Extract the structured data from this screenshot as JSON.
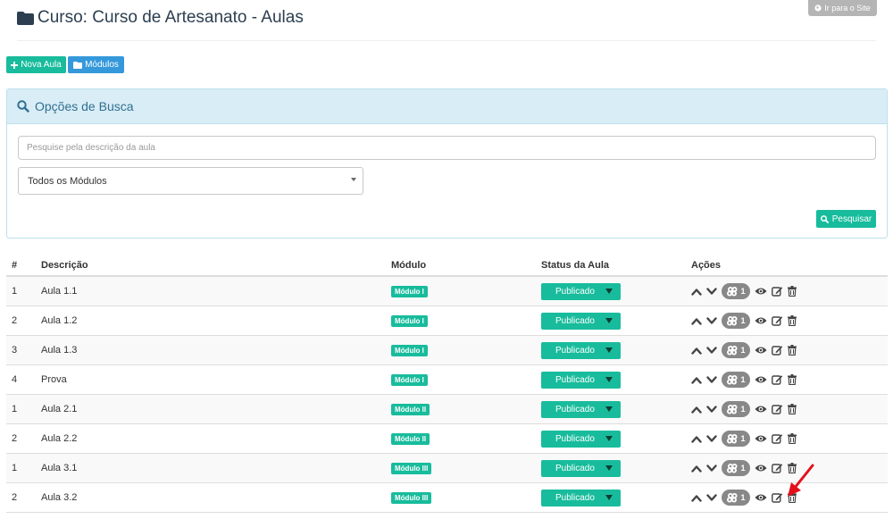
{
  "header": {
    "title": "Curso: Curso de Artesanato - Aulas",
    "site_button": "Ir para o Site"
  },
  "toolbar": {
    "new_lesson": "Nova Aula",
    "modules": "Módulos"
  },
  "search_panel": {
    "title": "Opções de Busca",
    "search_placeholder": "Pesquise pela descrição da aula",
    "module_select": "Todos os Módulos",
    "search_button": "Pesquisar"
  },
  "table": {
    "headers": {
      "num": "#",
      "description": "Descrição",
      "module": "Módulo",
      "status": "Status da Aula",
      "actions": "Ações"
    },
    "rows": [
      {
        "num": "1",
        "description": "Aula 1.1",
        "module": "Módulo I",
        "status": "Publicado",
        "resources": "1"
      },
      {
        "num": "2",
        "description": "Aula 1.2",
        "module": "Módulo I",
        "status": "Publicado",
        "resources": "1"
      },
      {
        "num": "3",
        "description": "Aula 1.3",
        "module": "Módulo I",
        "status": "Publicado",
        "resources": "1"
      },
      {
        "num": "4",
        "description": "Prova",
        "module": "Módulo I",
        "status": "Publicado",
        "resources": "1"
      },
      {
        "num": "1",
        "description": "Aula 2.1",
        "module": "Módulo II",
        "status": "Publicado",
        "resources": "1"
      },
      {
        "num": "2",
        "description": "Aula 2.2",
        "module": "Módulo II",
        "status": "Publicado",
        "resources": "1"
      },
      {
        "num": "1",
        "description": "Aula 3.1",
        "module": "Módulo III",
        "status": "Publicado",
        "resources": "1"
      },
      {
        "num": "2",
        "description": "Aula 3.2",
        "module": "Módulo III",
        "status": "Publicado",
        "resources": "1"
      }
    ]
  },
  "colors": {
    "primary_green": "#18bc9c",
    "info_blue": "#3498db",
    "panel_bg": "#d9edf7",
    "annotation_red": "#e3101b"
  },
  "icons": {
    "title": "folder-icon",
    "site": "globe-icon",
    "new": "plus-icon",
    "modules": "folder-icon",
    "search": "search-icon",
    "actions": [
      "chevron-up-icon",
      "chevron-down-icon",
      "resources-badge",
      "eye-icon",
      "edit-icon",
      "trash-icon"
    ]
  }
}
